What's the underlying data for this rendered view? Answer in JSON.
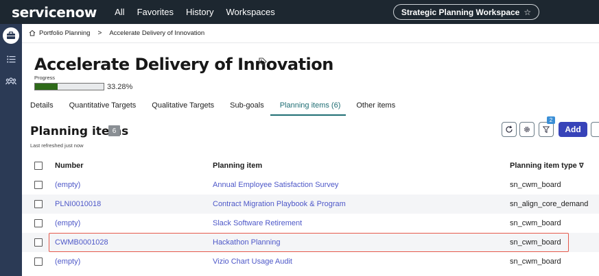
{
  "topbar": {
    "logo": "servicenow",
    "nav": [
      "All",
      "Favorites",
      "History",
      "Workspaces"
    ],
    "workspace": "Strategic Planning Workspace"
  },
  "breadcrumb": {
    "items": [
      "Portfolio Planning",
      "Accelerate Delivery of Innovation"
    ]
  },
  "record": {
    "title": "Accelerate Delivery of Innovation",
    "progress_label": "Progress",
    "progress_value": "33.28%",
    "progress_fraction": 0.3328
  },
  "tabs": [
    "Details",
    "Quantitative Targets",
    "Qualitative Targets",
    "Sub-goals",
    "Planning items (6)",
    "Other items"
  ],
  "list": {
    "title": "Planning items",
    "count": "6",
    "refreshed": "Last refreshed just now",
    "filter_badge": "2",
    "add_label": "Add",
    "columns": [
      "Number",
      "Planning item",
      "Planning item type"
    ],
    "rows": [
      {
        "number": "(empty)",
        "item": "Annual Employee Satisfaction Survey",
        "type": "sn_cwm_board"
      },
      {
        "number": "PLNI0010018",
        "item": "Contract Migration Playbook & Program",
        "type": "sn_align_core_demand"
      },
      {
        "number": "(empty)",
        "item": "Slack Software Retirement",
        "type": "sn_cwm_board"
      },
      {
        "number": "CWMB0001028",
        "item": "Hackathon Planning",
        "type": "sn_cwm_board"
      },
      {
        "number": "(empty)",
        "item": "Vizio Chart Usage Audit",
        "type": "sn_cwm_board"
      }
    ]
  },
  "colors": {
    "topbar": "#1d2730",
    "rail": "#2b3a55",
    "accent": "#3743b9",
    "link": "#4d57c8",
    "progress": "#2e6a19",
    "active_tab": "#1e6d73",
    "highlight": "#e6584a"
  }
}
